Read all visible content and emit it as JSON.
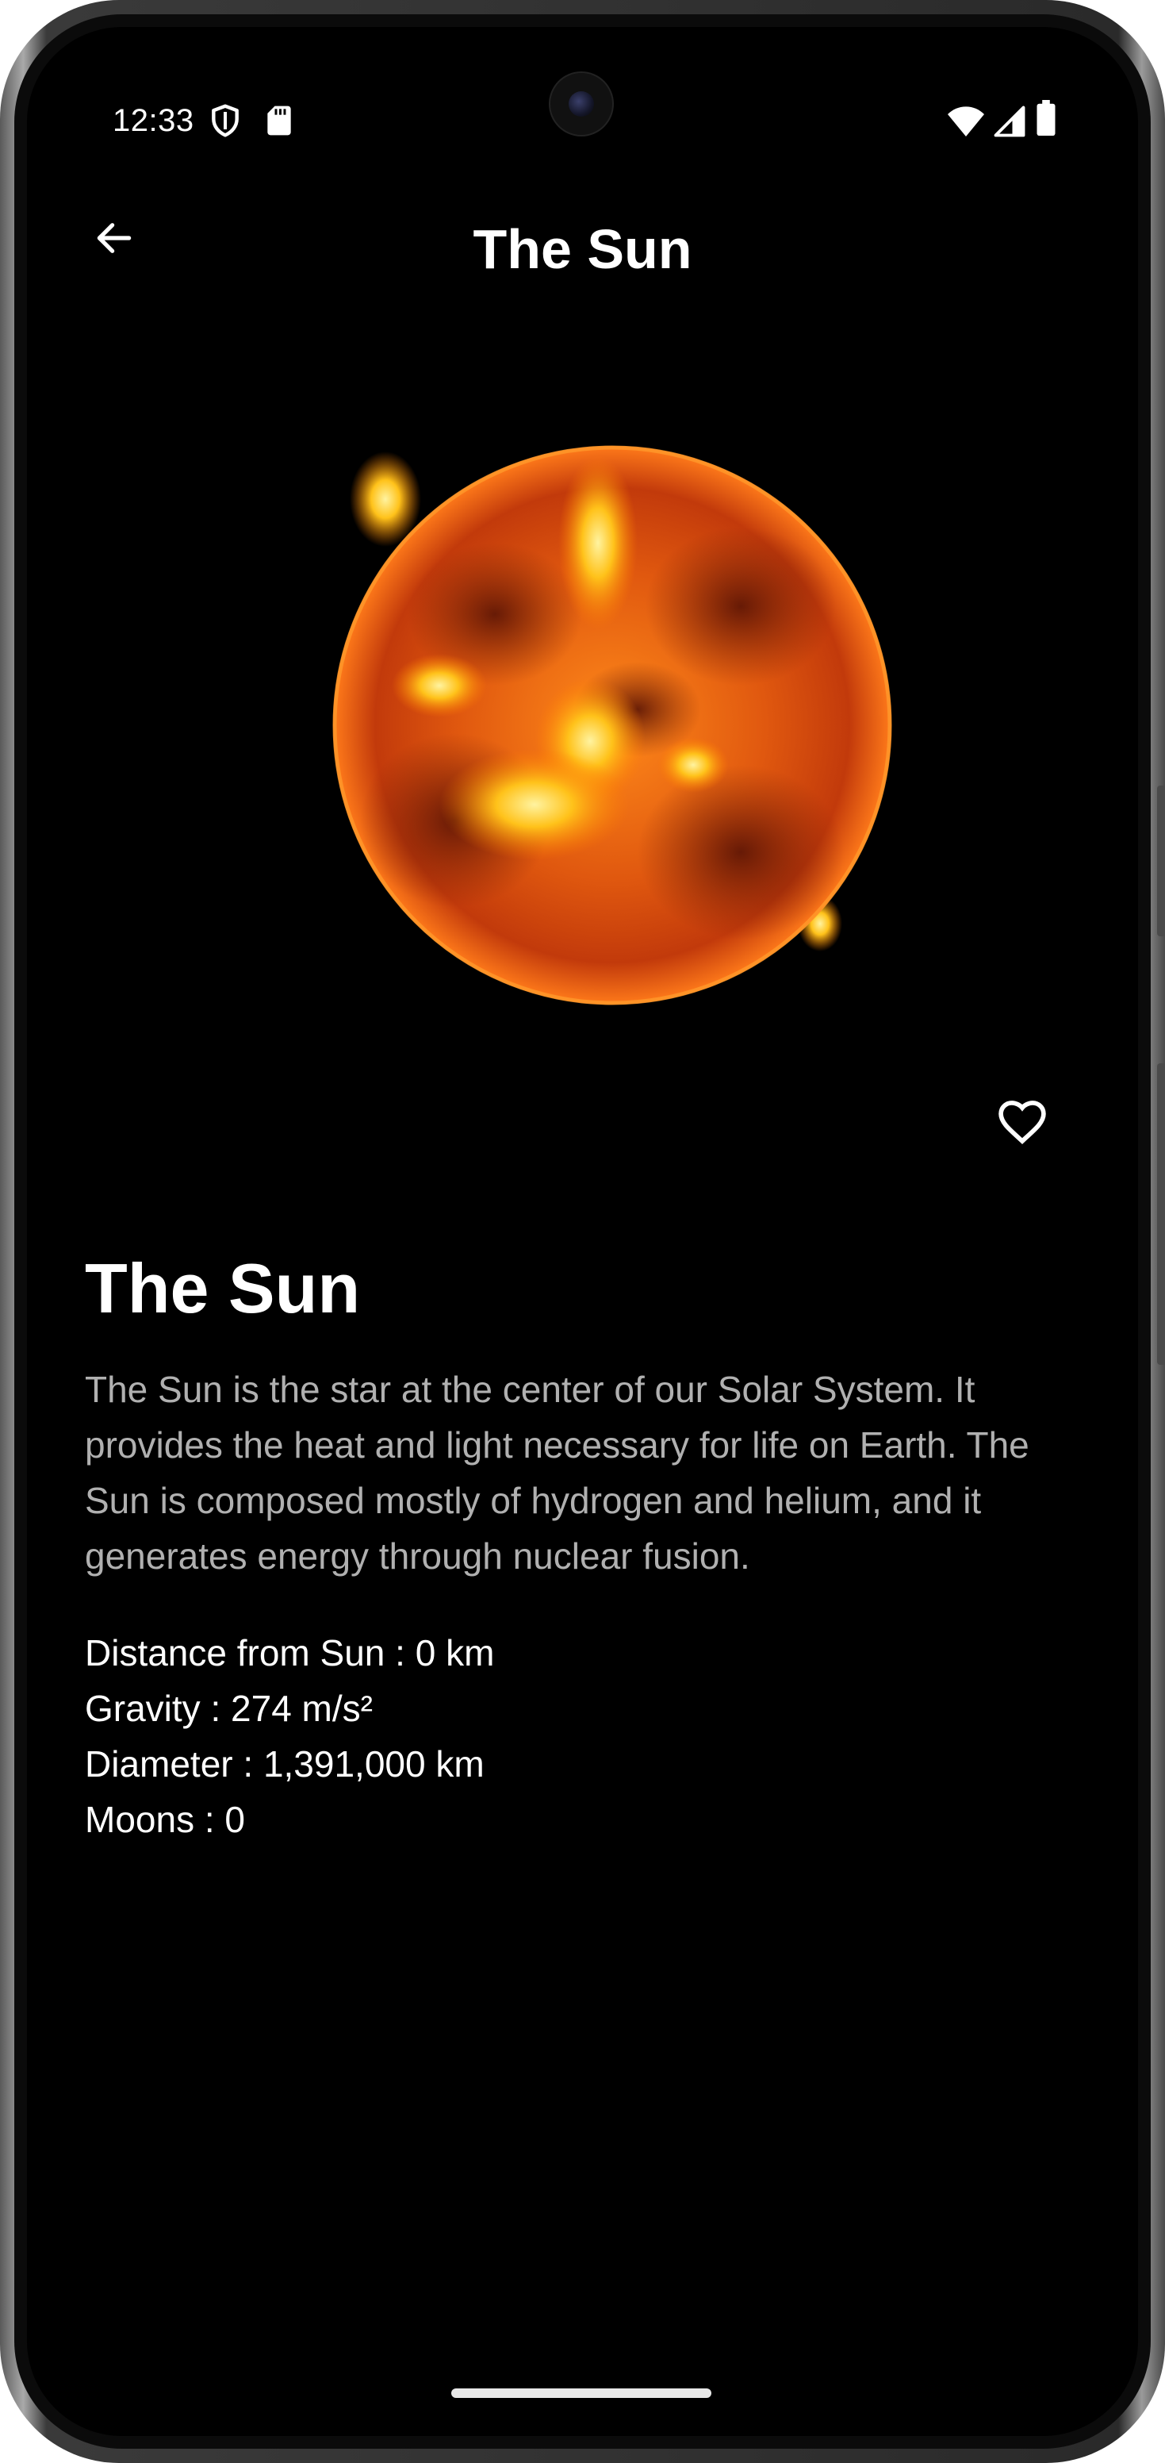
{
  "status_bar": {
    "time": "12:33",
    "icons": [
      "shield-icon",
      "sd-card-icon",
      "wifi-icon",
      "cellular-signal-icon",
      "battery-icon"
    ]
  },
  "app_bar": {
    "title": "The Sun",
    "back_icon": "arrow-back-icon"
  },
  "planet": {
    "name": "The Sun",
    "description": "The Sun is the star at the center of our Solar System. It provides the heat and light necessary for life on Earth. The Sun is composed mostly of hydrogen and helium, and it generates energy through nuclear fusion.",
    "favorite_icon": "heart-outline-icon",
    "facts": [
      "Distance from Sun : 0 km",
      "Gravity : 274 m/s²",
      "Diameter : 1,391,000 km",
      "Moons : 0"
    ]
  },
  "colors": {
    "background": "#000000",
    "text_primary": "#ffffff",
    "text_secondary": "#b0b0b0",
    "sun_core": "#ffb21a",
    "sun_edge": "#c2360a"
  }
}
